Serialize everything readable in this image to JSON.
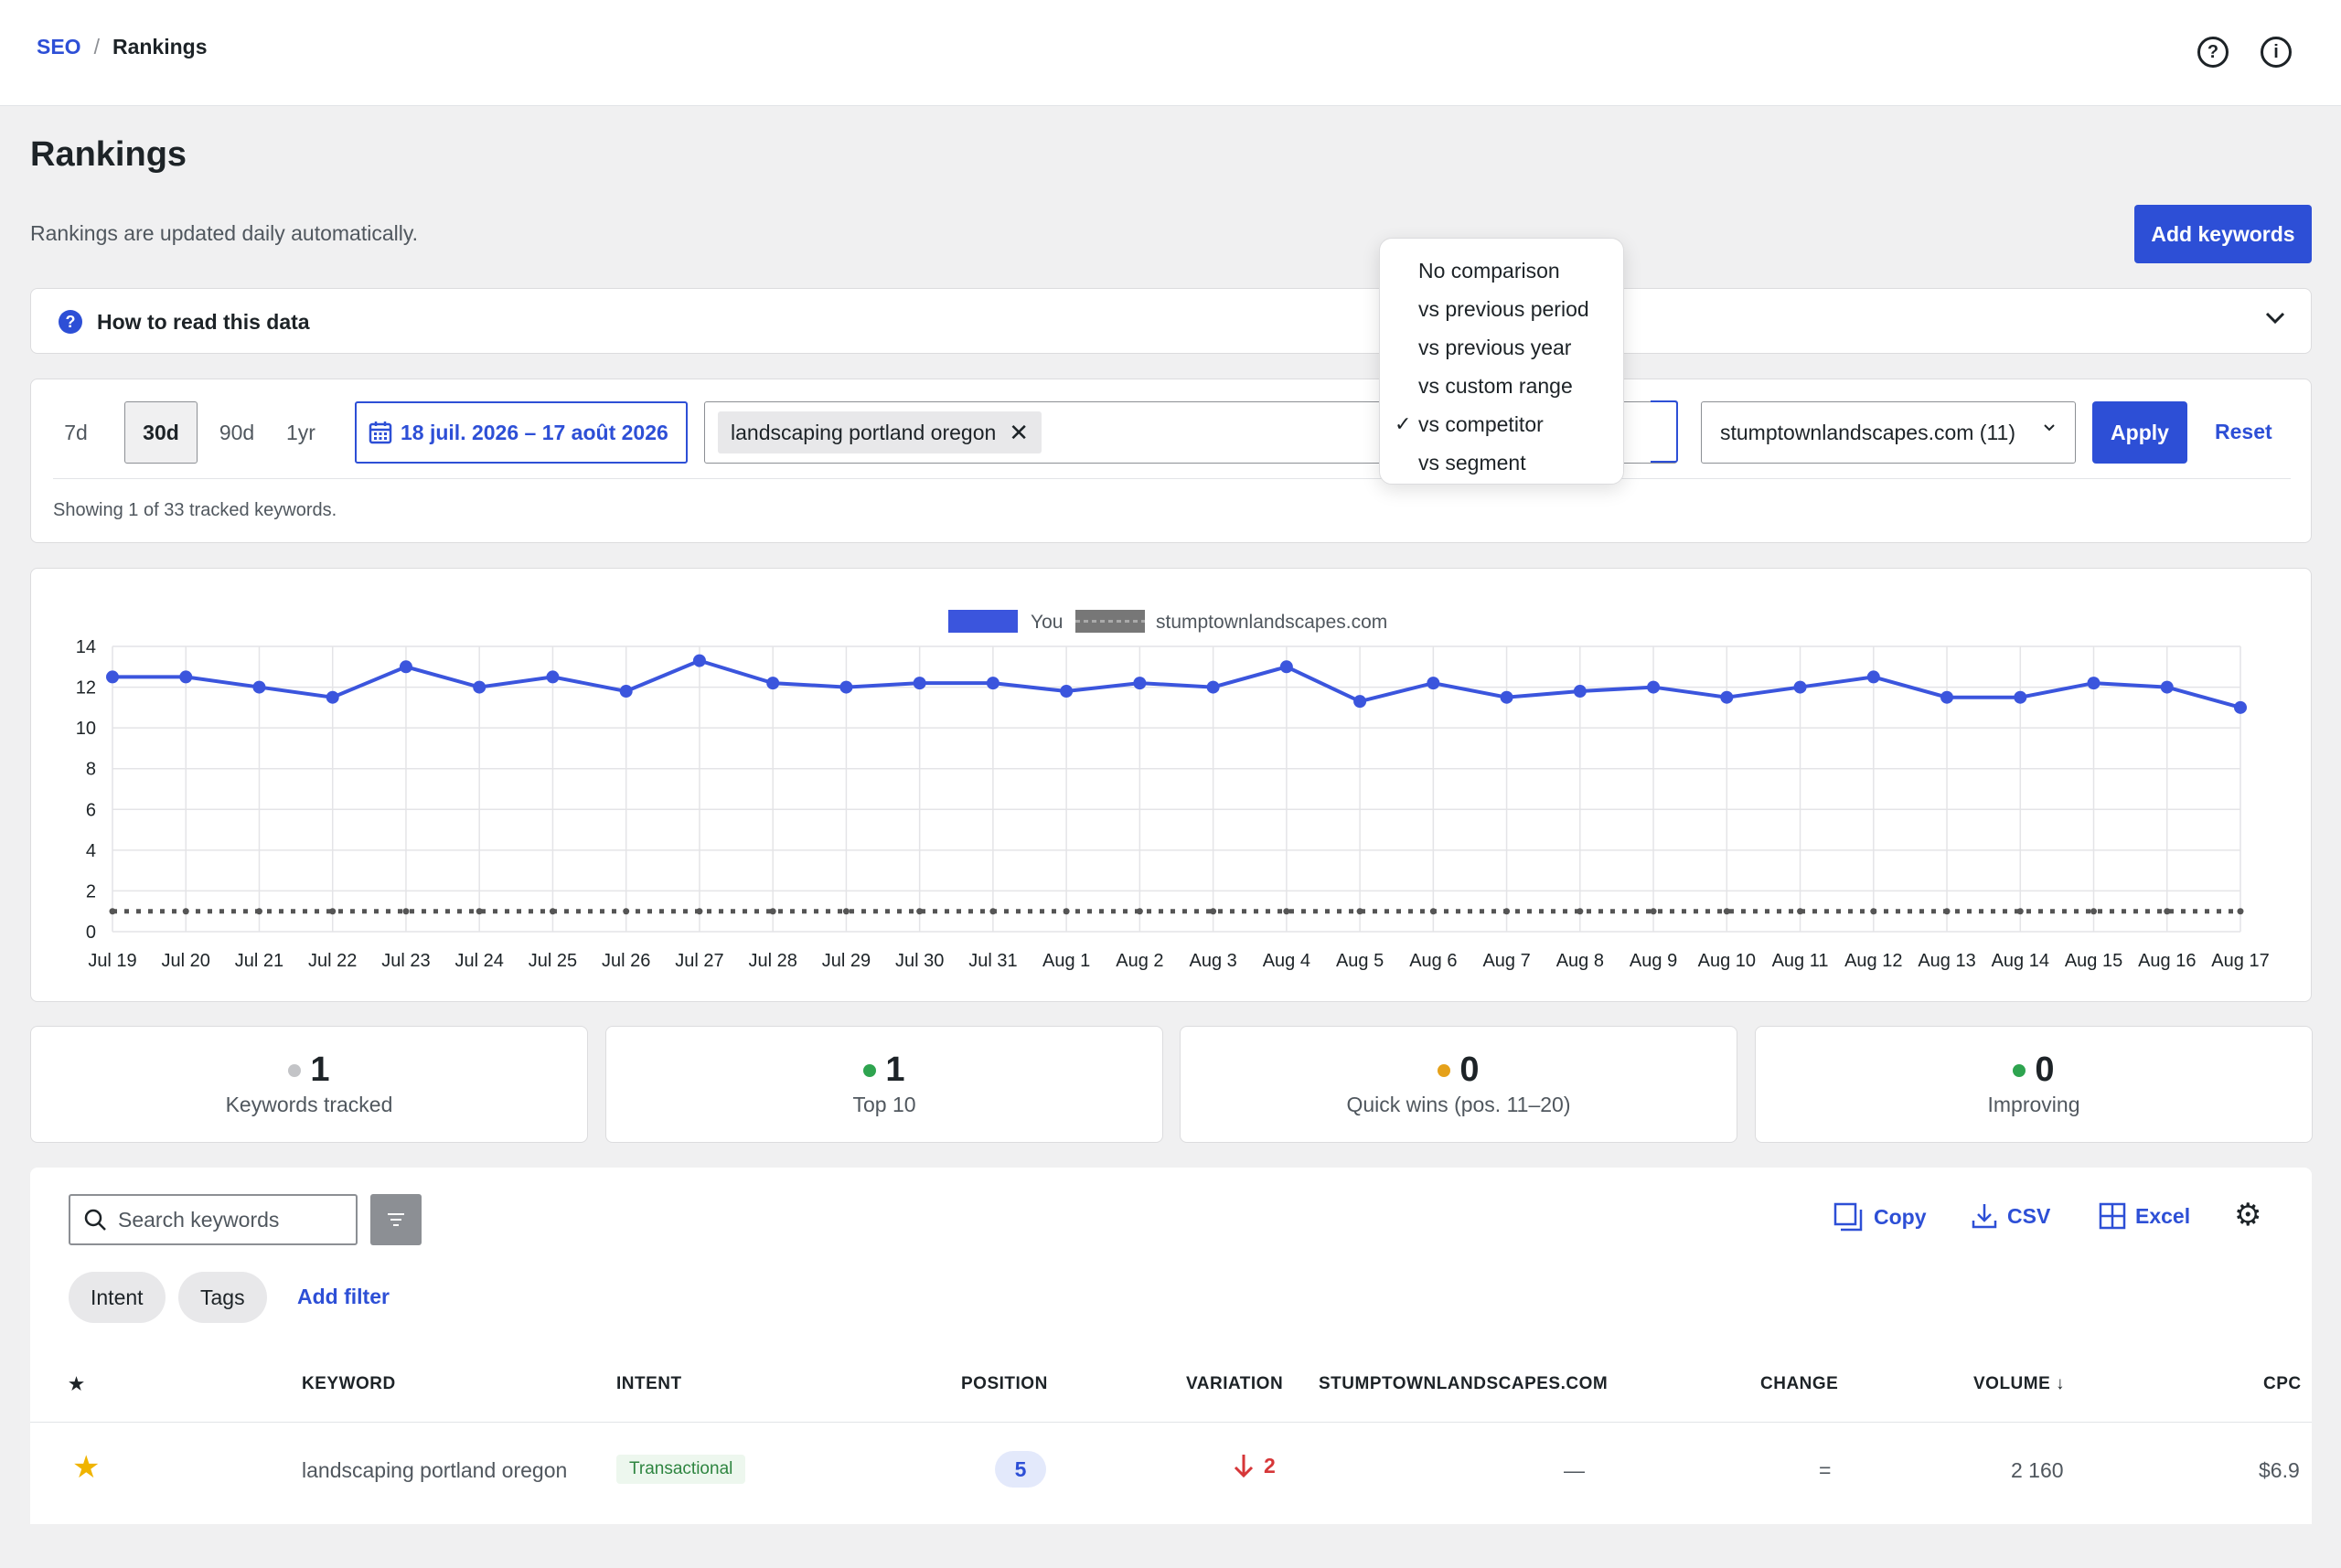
{
  "breadcrumb": {
    "parent": "SEO",
    "separator": "/",
    "current": "Rankings"
  },
  "header_icons": {
    "help": "?",
    "info": "i"
  },
  "page": {
    "title": "Rankings",
    "subtitle": "Rankings are updated daily automatically.",
    "add_keywords": "Add keywords"
  },
  "howto": {
    "label": "How to read this data",
    "icon": "?"
  },
  "filters": {
    "ranges": [
      "7d",
      "30d",
      "90d",
      "1yr"
    ],
    "active_range": "30d",
    "date_range": "18 juil. 2026 – 17 août 2026",
    "keyword_chip": "landscaping portland oregon",
    "domain_select": "stumptownlandscapes.com (11)",
    "apply": "Apply",
    "reset": "Reset",
    "showing": "Showing 1 of 33 tracked keywords."
  },
  "comparison_menu": {
    "items": [
      "No comparison",
      "vs previous period",
      "vs previous year",
      "vs custom range",
      "vs competitor",
      "vs segment"
    ],
    "selected": "vs competitor",
    "check": "✓"
  },
  "chart_data": {
    "type": "line",
    "legend": {
      "position": "top",
      "entries": [
        "You",
        "stumptownlandscapes.com"
      ]
    },
    "ylim": [
      0,
      14
    ],
    "yticks": [
      0,
      2,
      4,
      6,
      8,
      10,
      12,
      14
    ],
    "grid": true,
    "x": [
      "Jul 19",
      "Jul 20",
      "Jul 21",
      "Jul 22",
      "Jul 23",
      "Jul 24",
      "Jul 25",
      "Jul 26",
      "Jul 27",
      "Jul 28",
      "Jul 29",
      "Jul 30",
      "Jul 31",
      "Aug 1",
      "Aug 2",
      "Aug 3",
      "Aug 4",
      "Aug 5",
      "Aug 6",
      "Aug 7",
      "Aug 8",
      "Aug 9",
      "Aug 10",
      "Aug 11",
      "Aug 12",
      "Aug 13",
      "Aug 14",
      "Aug 15",
      "Aug 16",
      "Aug 17"
    ],
    "series": [
      {
        "name": "You",
        "color": "#3b55dd",
        "style": "solid",
        "values": [
          12.5,
          12.5,
          12.0,
          11.5,
          13.0,
          12.0,
          12.5,
          11.8,
          13.3,
          12.2,
          12.0,
          12.2,
          12.2,
          11.8,
          12.2,
          12.0,
          13.0,
          11.3,
          12.2,
          11.5,
          11.8,
          12.0,
          11.5,
          12.0,
          12.5,
          11.5,
          11.5,
          12.2,
          12.0,
          11.0
        ]
      },
      {
        "name": "stumptownlandscapes.com",
        "color": "#555555",
        "style": "dotted",
        "values": [
          1,
          1,
          1,
          1,
          1,
          1,
          1,
          1,
          1,
          1,
          1,
          1,
          1,
          1,
          1,
          1,
          1,
          1,
          1,
          1,
          1,
          1,
          1,
          1,
          1,
          1,
          1,
          1,
          1,
          1
        ]
      }
    ]
  },
  "stats": [
    {
      "value": "1",
      "label": "Keywords tracked",
      "color": "#c3c4c7"
    },
    {
      "value": "1",
      "label": "Top 10",
      "color": "#2ea44f"
    },
    {
      "value": "0",
      "label": "Quick wins (pos. 11–20)",
      "color": "#e5a11a"
    },
    {
      "value": "0",
      "label": "Improving",
      "color": "#2ea44f"
    }
  ],
  "table": {
    "search_placeholder": "Search keywords",
    "tools": {
      "copy": "Copy",
      "csv": "CSV",
      "excel": "Excel"
    },
    "pills": [
      "Intent",
      "Tags"
    ],
    "add_filter": "Add filter",
    "headers": {
      "star": "★",
      "keyword": "KEYWORD",
      "intent": "INTENT",
      "position": "POSITION",
      "variation": "VARIATION",
      "competitor": "STUMPTOWNLANDSCAPES.COM",
      "change": "CHANGE",
      "volume": "VOLUME ↓",
      "cpc": "CPC"
    },
    "rows": [
      {
        "star": "★",
        "keyword": "landscaping portland oregon",
        "intent": "Transactional",
        "position": "5",
        "variation": "2",
        "competitor": "—",
        "change": "=",
        "volume": "2 160",
        "cpc": "$6.9"
      }
    ]
  }
}
